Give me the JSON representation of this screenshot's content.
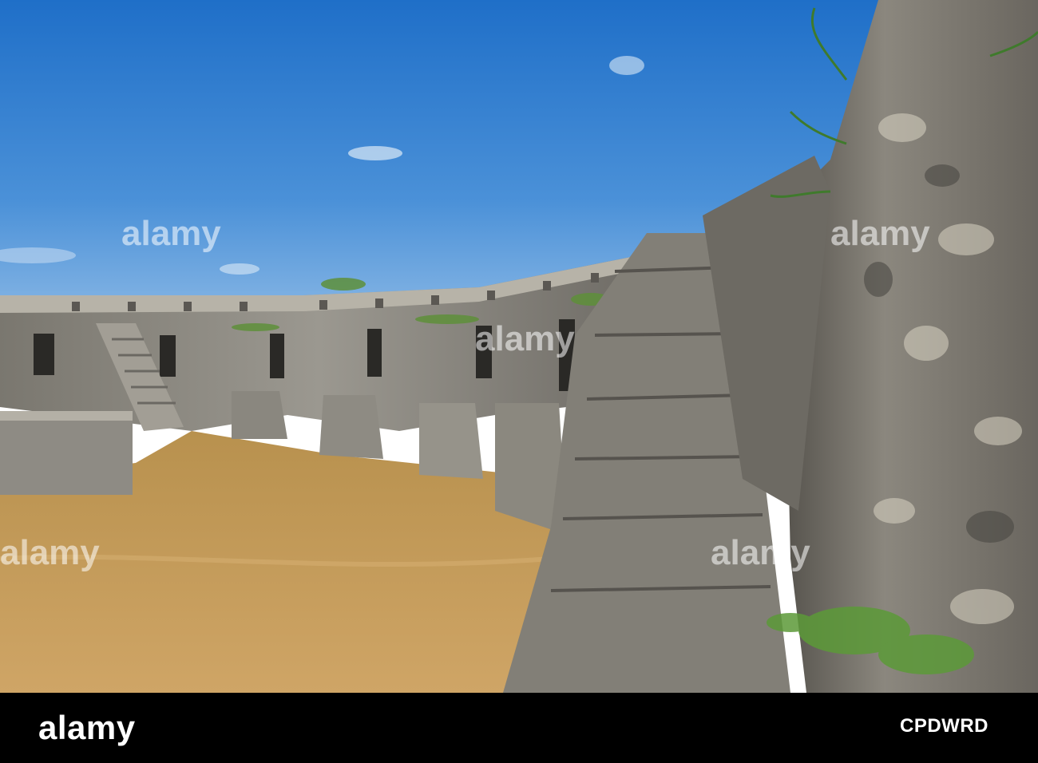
{
  "image": {
    "subject": "ruined stone fortress courtyard",
    "sky_color": "#2f7dd0",
    "grass_color": "#c59b55",
    "stone_color": "#8a8780"
  },
  "watermark": {
    "text": "alamy"
  },
  "footer": {
    "brand": "alamy",
    "image_id": "CPDWRD"
  }
}
